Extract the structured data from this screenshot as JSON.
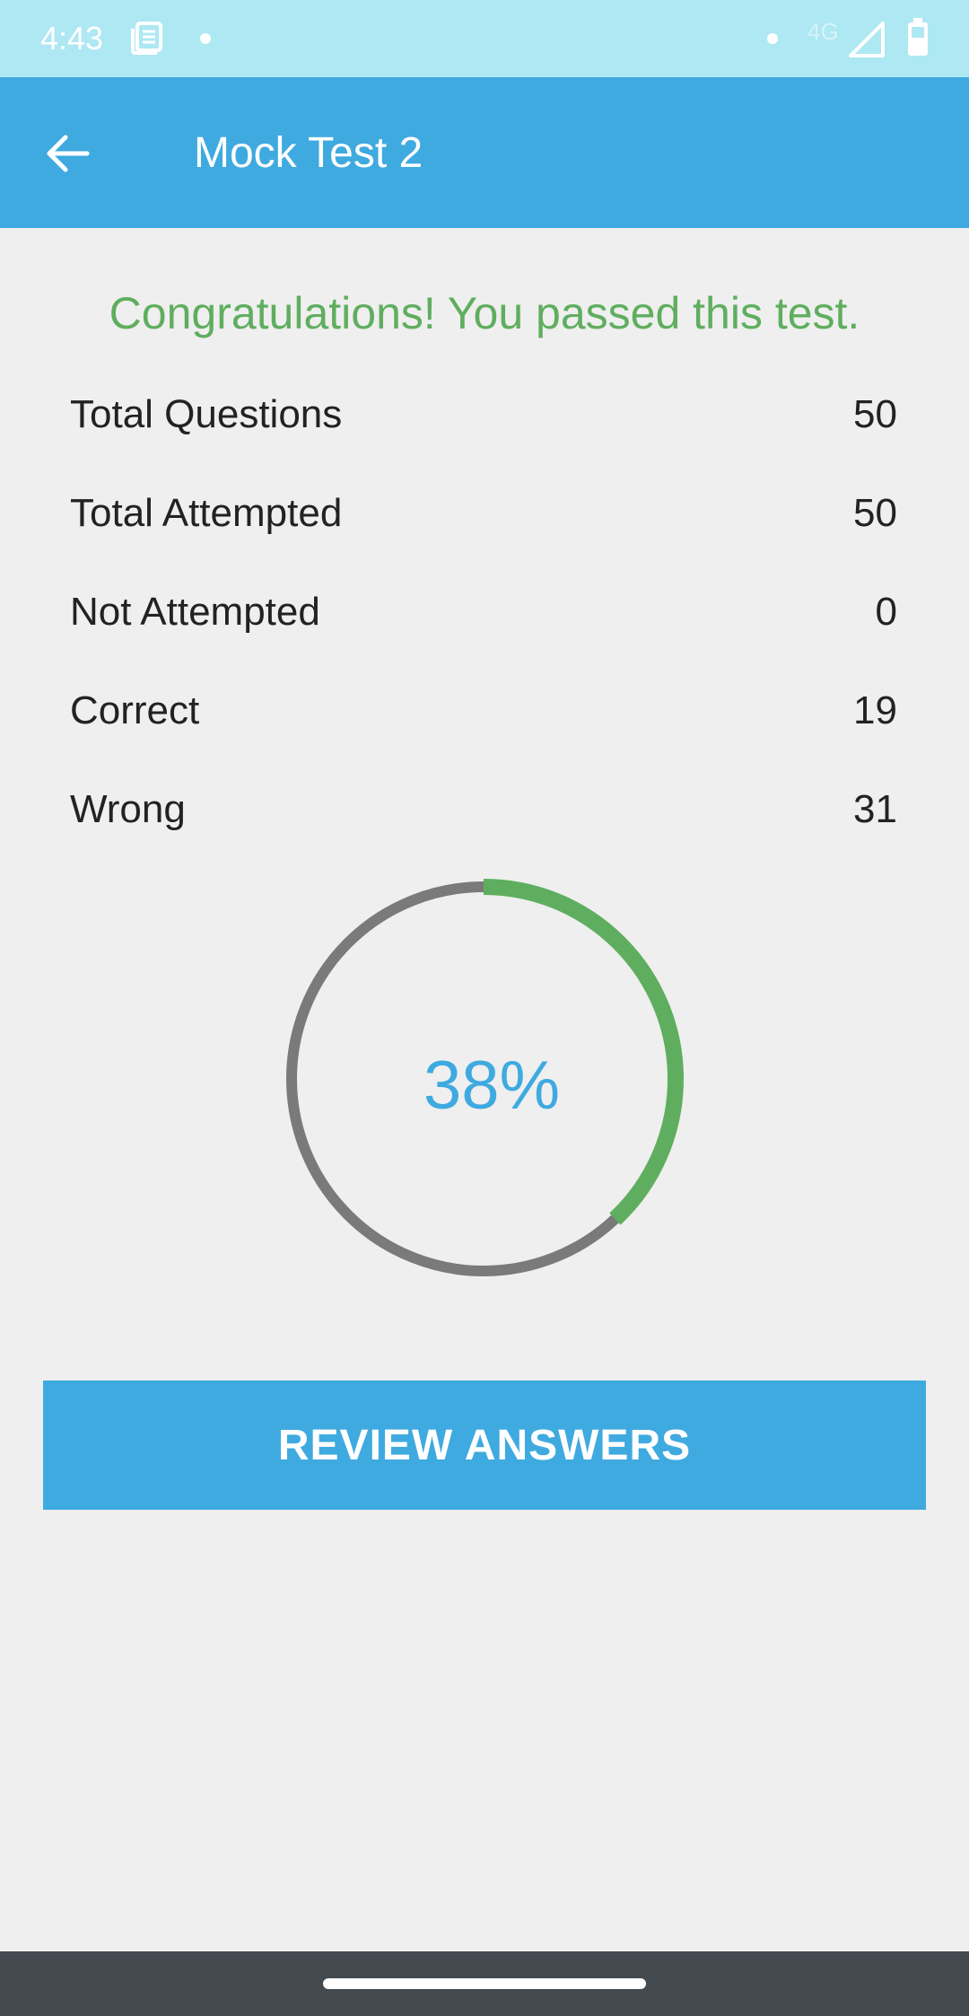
{
  "status_bar": {
    "time": "4:43",
    "network": "4G",
    "icons": [
      "news-icon",
      "notification-dot-icon",
      "signal-icon",
      "battery-icon"
    ]
  },
  "app_bar": {
    "title": "Mock Test 2",
    "back_icon": "arrow-left-icon"
  },
  "result": {
    "message": "Congratulations! You passed this test.",
    "stats": [
      {
        "label": "Total Questions",
        "value": "50"
      },
      {
        "label": "Total Attempted",
        "value": "50"
      },
      {
        "label": "Not Attempted",
        "value": "0"
      },
      {
        "label": "Correct",
        "value": "19"
      },
      {
        "label": "Wrong",
        "value": "31"
      }
    ],
    "percent_label": "38%",
    "progress_fraction": 0.38
  },
  "actions": {
    "review_label": "REVIEW ANSWERS"
  },
  "colors": {
    "status_bar": "#aee8f3",
    "primary": "#3faae0",
    "success": "#5fae5f",
    "ring_track": "#7a7a7a",
    "background": "#efefef",
    "nav_bar": "#434a50"
  }
}
